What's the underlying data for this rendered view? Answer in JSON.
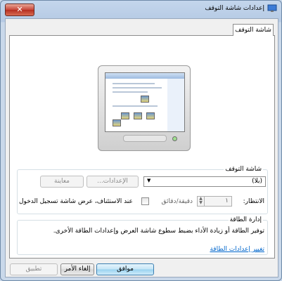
{
  "window": {
    "title": "إعدادات شاشة التوقف",
    "close_label": "✕"
  },
  "tabs": [
    {
      "label": "شاشة التوقف"
    }
  ],
  "screensaver": {
    "group_title": "شاشة التوقف",
    "selected": "(بلا)",
    "settings_label": "الإعدادات...",
    "preview_label": "معاينة",
    "wait_label": "الانتظار:",
    "wait_value": "١",
    "minutes_label": "دقيقة/دقائق",
    "resume_label": "عند الاستئناف، عرض شاشة تسجيل الدخول"
  },
  "power": {
    "group_title": "إدارة الطاقة",
    "description": "توفير الطاقة أو زيادة الأداء بضبط سطوع شاشة العرض وإعدادات الطاقة الأخرى.",
    "link": "تغيير إعدادات الطاقة"
  },
  "buttons": {
    "ok": "موافق",
    "cancel": "إلغاء الأمر",
    "apply": "تطبيق"
  },
  "icons": {
    "title": "screensaver-icon",
    "close": "close-icon"
  }
}
